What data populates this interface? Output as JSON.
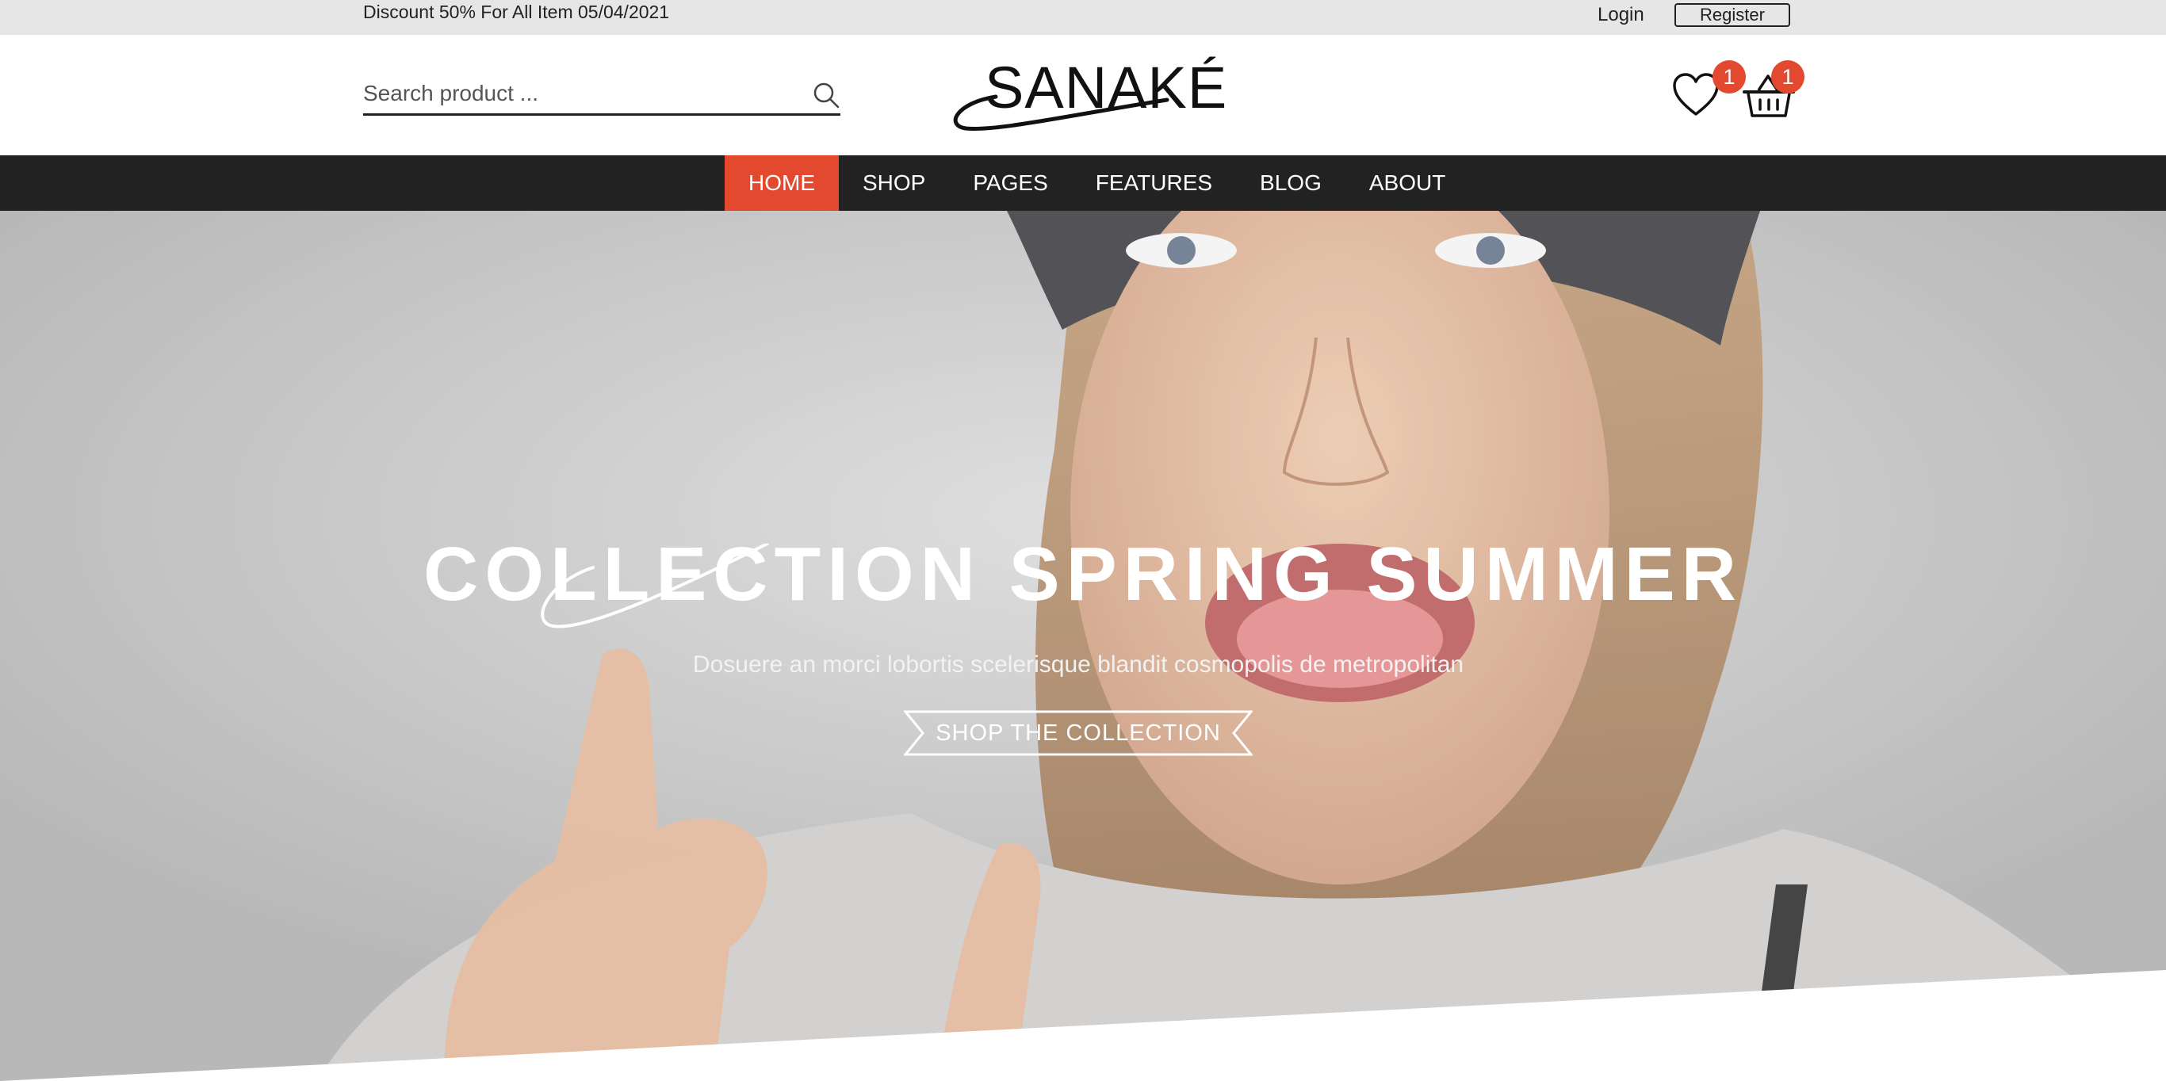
{
  "topbar": {
    "promo": "Discount 50% For All Item 05/04/2021",
    "login": "Login",
    "register": "Register"
  },
  "header": {
    "search_placeholder": "Search product ...",
    "logo": "SANAKÉ",
    "wishlist_count": "1",
    "cart_count": "1"
  },
  "nav": {
    "items": [
      "HOME",
      "SHOP",
      "PAGES",
      "FEATURES",
      "BLOG",
      "ABOUT"
    ],
    "active": "HOME"
  },
  "hero": {
    "title": "COLLECTION SPRING SUMMER",
    "subtitle": "Dosuere an morci lobortis scelerisque blandit cosmopolis de metropolitan",
    "cta": "SHOP THE COLLECTION"
  },
  "colors": {
    "accent": "#e2492f",
    "nav_bg": "#222222",
    "topbar_bg": "#e6e6e6"
  },
  "icons": [
    "search-icon",
    "heart-icon",
    "basket-icon"
  ]
}
